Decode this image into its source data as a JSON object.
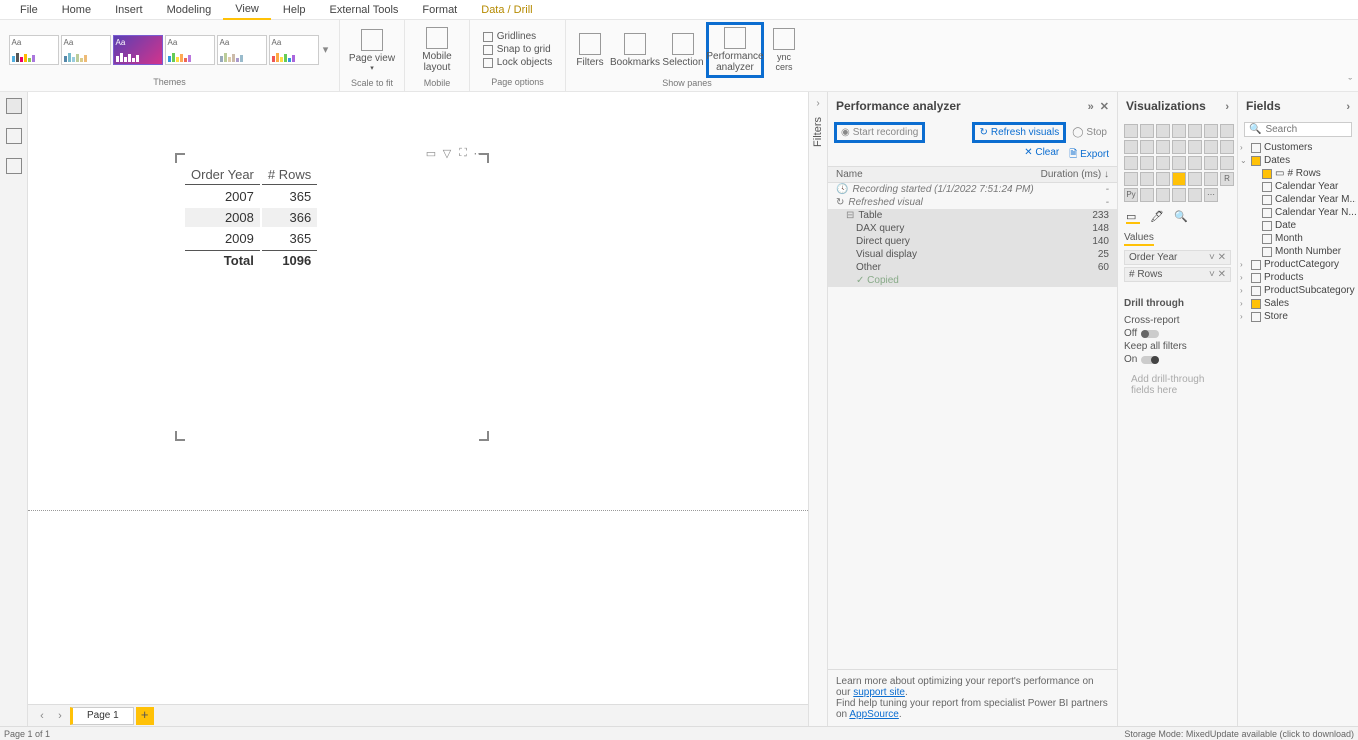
{
  "tabs": {
    "file": "File",
    "home": "Home",
    "insert": "Insert",
    "modeling": "Modeling",
    "view": "View",
    "help": "Help",
    "external": "External Tools",
    "format": "Format",
    "data": "Data / Drill"
  },
  "ribbon": {
    "themes_label": "Themes",
    "scale_label": "Scale to fit",
    "mobile_label": "Mobile",
    "pageopt_label": "Page options",
    "showpanes_label": "Show panes",
    "page_view": "Page view",
    "mobile_layout": "Mobile layout",
    "gridlines": "Gridlines",
    "snap": "Snap to grid",
    "lock": "Lock objects",
    "filters": "Filters",
    "bookmarks": "Bookmarks",
    "selection": "Selection",
    "perf": "Performance analyzer",
    "sync": "Sync slicers"
  },
  "canvas": {
    "table": {
      "col1": "Order Year",
      "col2": "# Rows",
      "rows": [
        {
          "year": "2007",
          "rows": "365"
        },
        {
          "year": "2008",
          "rows": "366"
        },
        {
          "year": "2009",
          "rows": "365"
        }
      ],
      "total_label": "Total",
      "total_value": "1096"
    }
  },
  "page_tabs": {
    "page1": "Page 1"
  },
  "filters": {
    "label": "Filters"
  },
  "perf": {
    "title": "Performance analyzer",
    "start": "Start recording",
    "refresh": "Refresh visuals",
    "stop": "Stop",
    "clear": "Clear",
    "export": "Export",
    "col_name": "Name",
    "col_dur": "Duration (ms)",
    "row_recstart": "Recording started (1/1/2022 7:51:24 PM)",
    "row_refreshed": "Refreshed visual",
    "row_table": "Table",
    "dur_table": "233",
    "row_dax": "DAX query",
    "dur_dax": "148",
    "row_dq": "Direct query",
    "dur_dq": "140",
    "row_vd": "Visual display",
    "dur_vd": "25",
    "row_other": "Other",
    "dur_other": "60",
    "row_copied": "Copied",
    "footer1": "Learn more about optimizing your report's performance on our ",
    "footer1_link": "support site",
    "footer2": "Find help tuning your report from specialist Power BI partners on ",
    "footer2_link": "AppSource"
  },
  "viz": {
    "title": "Visualizations",
    "values": "Values",
    "well1": "Order Year",
    "well2": "# Rows",
    "drill": "Drill through",
    "cross": "Cross-report",
    "off": "Off",
    "keep": "Keep all filters",
    "on": "On",
    "drop": "Add drill-through fields here"
  },
  "fields": {
    "title": "Fields",
    "search_ph": "Search",
    "tables": {
      "customers": "Customers",
      "dates": "Dates",
      "productcat": "ProductCategory",
      "products": "Products",
      "productsub": "ProductSubcategory",
      "sales": "Sales",
      "store": "Store"
    },
    "date_cols": {
      "rows": "# Rows",
      "caly": "Calendar Year",
      "calym": "Calendar Year M...",
      "calyn": "Calendar Year N...",
      "date": "Date",
      "month": "Month",
      "monthn": "Month Number"
    }
  },
  "status": {
    "left": "Page 1 of 1",
    "right": "Storage Mode: MixedUpdate available (click to download)"
  }
}
